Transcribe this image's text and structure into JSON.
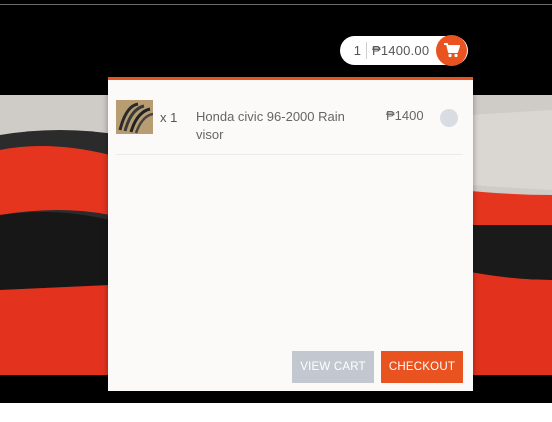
{
  "cart": {
    "count": "1",
    "total": "₱1400.00",
    "icon": "shopping-cart-icon",
    "accent_color": "#e8531f"
  },
  "mini_cart": {
    "items": [
      {
        "quantity": "x 1",
        "name": "Honda civic 96-2000 Rain visor",
        "price": "₱1400"
      }
    ],
    "view_cart_label": "VIEW CART",
    "checkout_label": "CHECKOUT"
  }
}
